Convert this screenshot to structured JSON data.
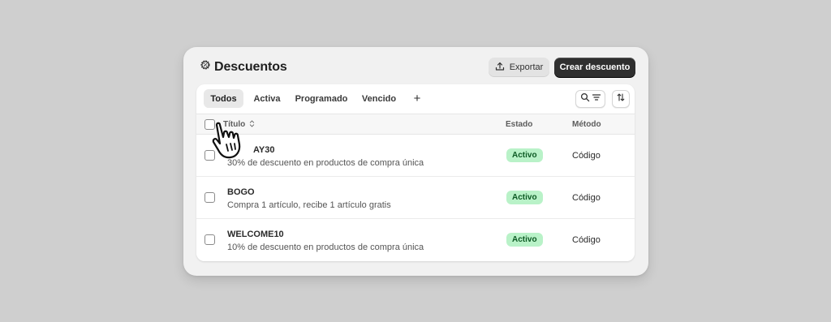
{
  "header": {
    "title": "Descuentos",
    "export_label": "Exportar",
    "create_label": "Crear descuento"
  },
  "tabs": [
    {
      "label": "Todos",
      "active": true
    },
    {
      "label": "Activa",
      "active": false
    },
    {
      "label": "Programado",
      "active": false
    },
    {
      "label": "Vencido",
      "active": false
    }
  ],
  "add_tab_label": "+",
  "table": {
    "columns": {
      "title": "Título",
      "status": "Estado",
      "method": "Método"
    },
    "rows": [
      {
        "code": "AY30",
        "description": "30% de descuento en productos de compra única",
        "status": "Activo",
        "method": "Código"
      },
      {
        "code": "BOGO",
        "description": "Compra 1 artículo, recibe 1 artículo gratis",
        "status": "Activo",
        "method": "Código"
      },
      {
        "code": "WELCOME10",
        "description": "10% de descuento en productos de compra única",
        "status": "Activo",
        "method": "Código"
      }
    ]
  },
  "icons": {
    "title": "discount-gear-icon",
    "export": "upload-icon",
    "search": "search-icon",
    "filter": "filter-icon",
    "sort": "sort-arrows-icon",
    "cursor": "hand-pointer-icon"
  },
  "colors": {
    "primary_button": "#2f2f2f",
    "badge_bg": "#b9f2c8",
    "badge_text": "#0d5a24",
    "background": "#cfcfcf"
  }
}
